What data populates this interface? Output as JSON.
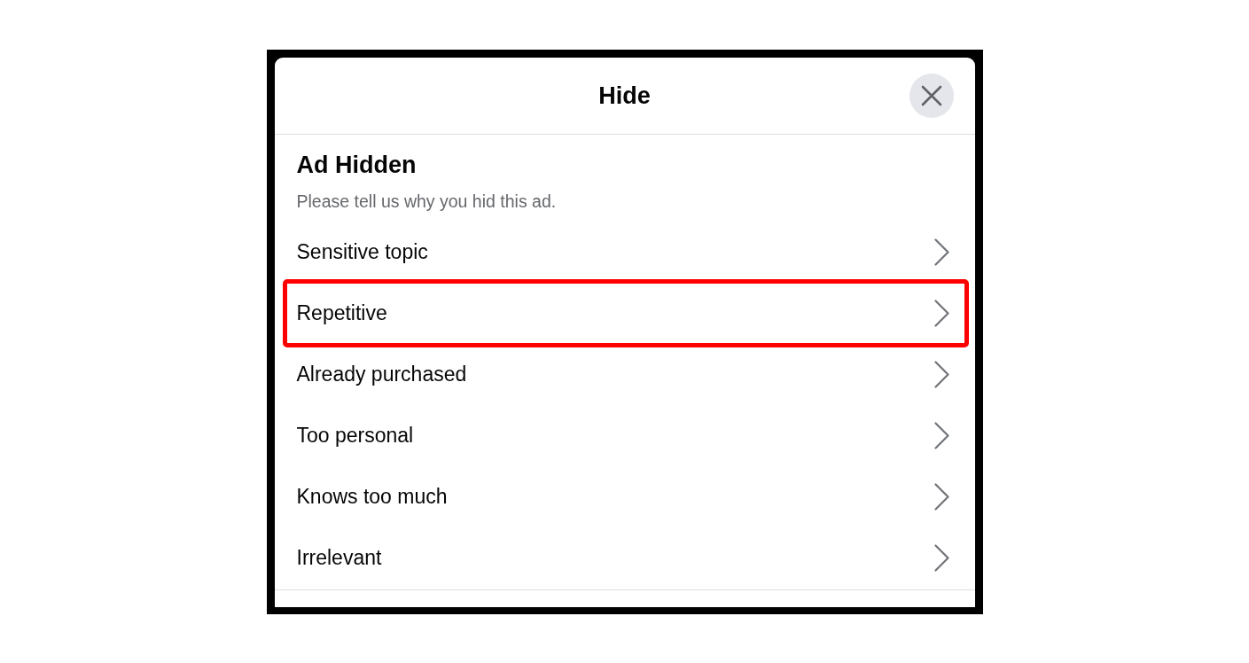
{
  "dialog": {
    "title": "Hide",
    "heading": "Ad Hidden",
    "subtitle": "Please tell us why you hid this ad.",
    "reasons": [
      {
        "label": "Sensitive topic",
        "highlighted": false
      },
      {
        "label": "Repetitive",
        "highlighted": true
      },
      {
        "label": "Already purchased",
        "highlighted": false
      },
      {
        "label": "Too personal",
        "highlighted": false
      },
      {
        "label": "Knows too much",
        "highlighted": false
      },
      {
        "label": "Irrelevant",
        "highlighted": false
      }
    ]
  }
}
